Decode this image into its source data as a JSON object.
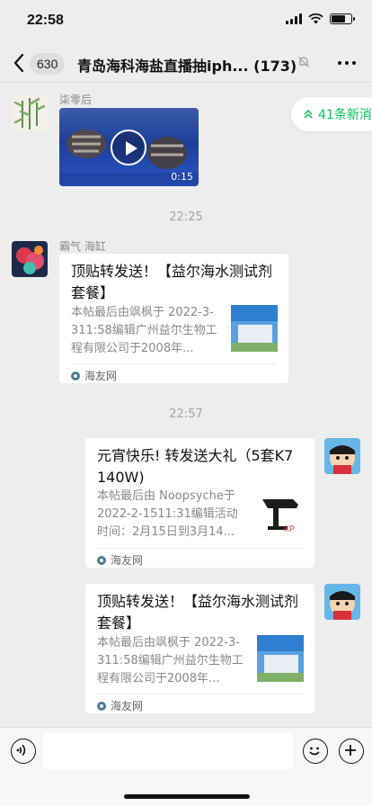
{
  "status_bar": {
    "time": "22:58"
  },
  "nav": {
    "unread_count": "630",
    "title": "青岛海科海盐直播抽iph...",
    "member_count": "(173)"
  },
  "new_messages": {
    "label": "41条新消"
  },
  "messages": [
    {
      "sender": "柒零后",
      "type": "video",
      "duration": "0:15"
    },
    {
      "type": "time",
      "text": "22:25"
    },
    {
      "sender": "霸气 海缸",
      "type": "link",
      "title": "顶贴转发送！【益尔海水测试剂套餐】",
      "desc": "本帖最后由飒枫于 2022-3-311:58编辑广州益尔生物工程有限公司于2008年...",
      "source": "海友网"
    },
    {
      "type": "time",
      "text": "22:57"
    },
    {
      "type": "link",
      "title": "元宵快乐! 转发送大礼（5套K7 140W)",
      "desc": "本帖最后由 Noopsyche于 2022-2-1511:31编辑活动时间：2月15日到3月14...",
      "source": "海友网"
    },
    {
      "type": "link",
      "title": "顶贴转发送！【益尔海水测试剂套餐】",
      "desc": "本帖最后由飒枫于 2022-3-311:58编辑广州益尔生物工程有限公司于2008年...",
      "source": "海友网"
    }
  ],
  "theme": {
    "accent": "#07c160",
    "background": "#ededed"
  }
}
